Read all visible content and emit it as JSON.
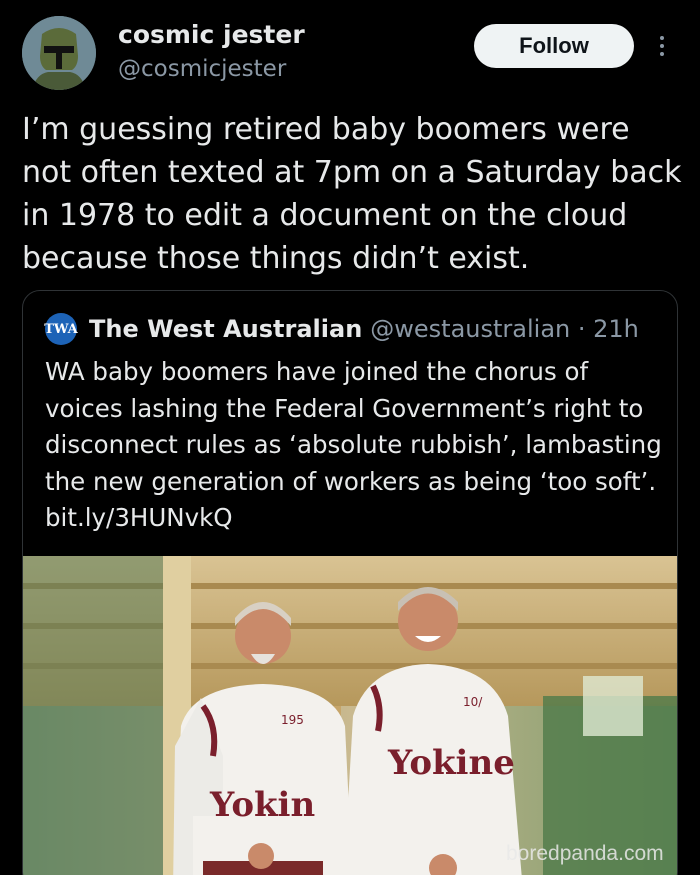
{
  "author": {
    "name": "cosmic jester",
    "handle": "@cosmicjester",
    "follow_label": "Follow"
  },
  "tweet": {
    "text": "I’m guessing retired baby boomers were not often texted at 7pm on a Saturday back in 1978 to edit a document on the cloud because those things didn’t exist."
  },
  "quote": {
    "logo_text": "TWA",
    "name": "The West Australian",
    "handle_time": "@westaustralian · 21h",
    "text": "WA baby boomers have joined the chorus of voices lashing the Federal Government’s right to disconnect rules as ‘absolute rubbish’, lambasting the new generation of workers as being ‘too soft’. bit.ly/3HUNvkQ",
    "photo": {
      "shirt_text_left": "Yokin",
      "shirt_text_right": "Yokine",
      "shirt_small_left": "195",
      "shirt_small_right": "10/"
    }
  },
  "watermark": "boredpanda.com",
  "colors": {
    "background": "#000000",
    "text": "#e7e9ea",
    "secondary": "#8b98a5",
    "follow_bg": "#eff3f4",
    "logo_blue": "#1d63b7",
    "shirt_maroon": "#7a1f2c"
  }
}
